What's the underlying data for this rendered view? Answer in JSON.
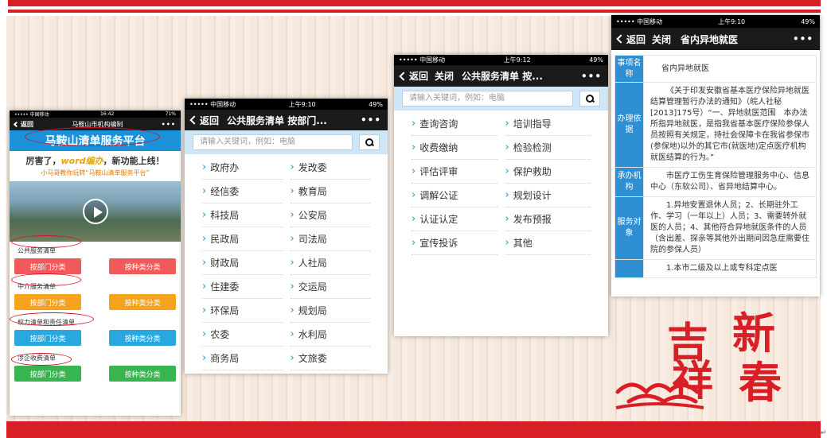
{
  "phone1": {
    "status": {
      "carrier": "••••• 中国移动",
      "time": "16:42",
      "battery": "71%"
    },
    "nav": {
      "back": "返回",
      "title": "马鞍山市机构编制",
      "more": "•••"
    },
    "banner": "马鞍山清单服务平台",
    "promo_prefix": "厉害了，",
    "promo_highlight": "word编办",
    "promo_suffix": "，新功能上线！",
    "promo_sub": "小马哥教你玩转“马鞍山清单服务平台”",
    "sections": [
      {
        "label": "公共服务清单",
        "left": "按部门分类",
        "right": "按种类分类"
      },
      {
        "label": "中介服务清单",
        "left": "按部门分类",
        "right": "按种类分类"
      },
      {
        "label": "权力清单和责任清单",
        "left": "按部门分类",
        "right": "按种类分类"
      },
      {
        "label": "涉企收费清单",
        "left": "按部门分类",
        "right": "按种类分类"
      }
    ]
  },
  "phone2": {
    "status": {
      "carrier": "••••• 中国移动",
      "time": "上午9:10",
      "battery": "49%"
    },
    "nav": {
      "back": "返回",
      "title": "公共服务清单 按部门...",
      "more": "•••"
    },
    "search_placeholder": "请输入关键词，例如：电脑",
    "items": [
      "政府办",
      "发改委",
      "经信委",
      "教育局",
      "科技局",
      "公安局",
      "民政局",
      "司法局",
      "财政局",
      "人社局",
      "住建委",
      "交运局",
      "环保局",
      "规划局",
      "农委",
      "水利局",
      "商务局",
      "文旅委"
    ]
  },
  "phone3": {
    "status": {
      "carrier": "••••• 中国移动",
      "time": "上午9:12",
      "battery": "49%"
    },
    "nav": {
      "back": "返回",
      "close": "关闭",
      "title": "公共服务清单 按...",
      "more": "•••"
    },
    "search_placeholder": "请输入关键词，例如：电脑",
    "items": [
      "查询咨询",
      "培训指导",
      "收费缴纳",
      "检验检测",
      "评估评审",
      "保护救助",
      "调解公证",
      "规划设计",
      "认证认定",
      "发布预报",
      "宣传投诉",
      "其他"
    ]
  },
  "phone4": {
    "status": {
      "carrier": "••••• 中国移动",
      "time": "上午9:10",
      "battery": "49%"
    },
    "nav": {
      "back": "返回",
      "close": "关闭",
      "title": "省内异地就医",
      "more": "•••"
    },
    "rows": [
      {
        "label": "事项名称",
        "value": "省内异地就医"
      },
      {
        "label": "办理依据",
        "value": "《关于印发安徽省基本医疗保险异地就医结算管理暂行办法的通知》（皖人社秘[2013]175号）“一、异地就医范围　本办法所指异地就医，是指我省基本医疗保险参保人员按照有关规定，持社会保障卡在我省参保市(参保地)以外的其它市(就医地)定点医疗机构就医结算的行为。”"
      },
      {
        "label": "承办机构",
        "value": "市医疗工伤生育保险管理服务中心、信息中心（东软公司）、省异地结算中心。"
      },
      {
        "label": "服务对象",
        "value": "1.异地安置退休人员；2、长期驻外工作、学习（一年以上）人员；3、需要转外就医的人员；4、其他符合异地就医条件的人员（含出差、探亲等其他外出期间因急症需要住院的参保人员）"
      },
      {
        "label": "",
        "value": "1.本市二级及以上或专科定点医"
      }
    ]
  },
  "decoration": {
    "chars": [
      "新",
      "吉",
      "春",
      "祥"
    ]
  },
  "corner_mark": "↵"
}
